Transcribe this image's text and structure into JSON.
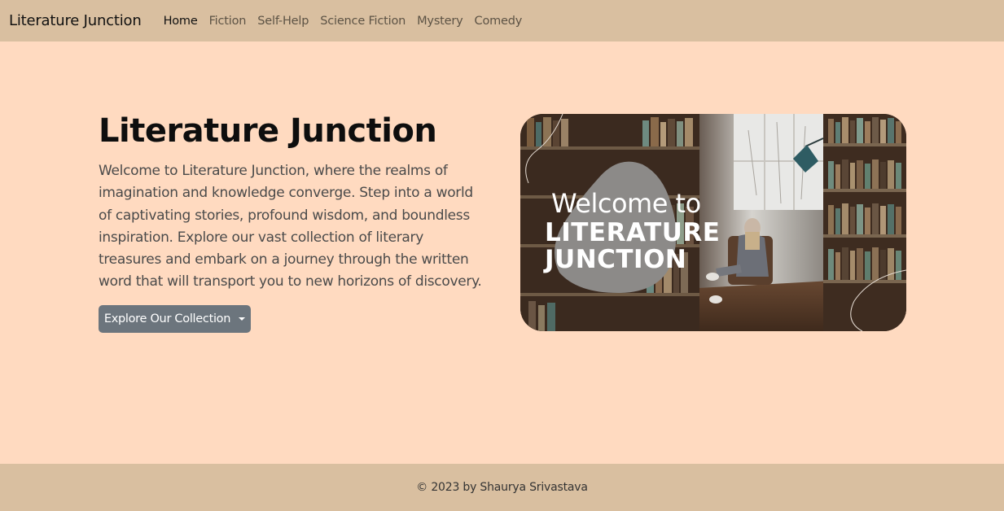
{
  "navbar": {
    "brand": "Literature Junction",
    "links": [
      {
        "label": "Home",
        "active": true
      },
      {
        "label": "Fiction",
        "active": false
      },
      {
        "label": "Self-Help",
        "active": false
      },
      {
        "label": "Science Fiction",
        "active": false
      },
      {
        "label": "Mystery",
        "active": false
      },
      {
        "label": "Comedy",
        "active": false
      }
    ]
  },
  "hero": {
    "title": "Literature Junction",
    "description": "Welcome to Literature Junction, where the realms of imagination and knowledge converge. Step into a world of captivating stories, profound wisdom, and boundless inspiration. Explore our vast collection of literary treasures and embark on a journey through the written word that will transport you to new horizons of discovery.",
    "button_label": "Explore Our Collection",
    "image": {
      "welcome": "Welcome to",
      "title_line1": "LITERATURE",
      "title_line2": "JUNCTION"
    }
  },
  "footer": {
    "text": "© 2023 by Shaurya Srivastava"
  },
  "colors": {
    "background": "#ffdac0",
    "navbar": "#d9bfa0",
    "button": "#6c757d"
  }
}
